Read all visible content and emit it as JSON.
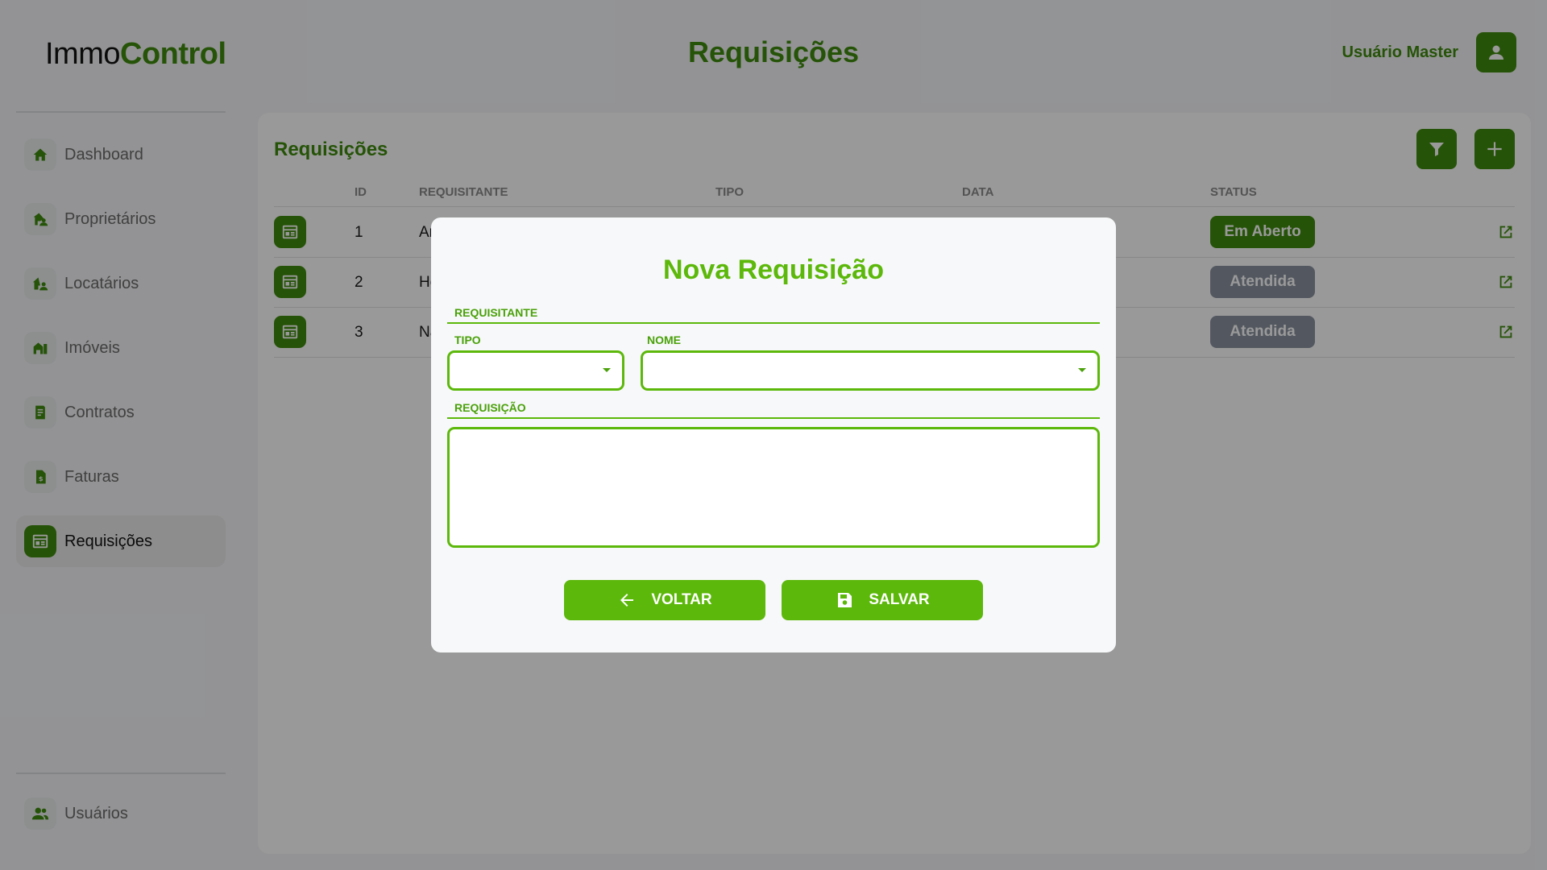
{
  "logo": {
    "part1": "Immo",
    "part2": "Control"
  },
  "header": {
    "title": "Requisições",
    "user_name": "Usuário Master"
  },
  "sidebar": {
    "items": [
      {
        "label": "Dashboard",
        "icon": "home-icon"
      },
      {
        "label": "Proprietários",
        "icon": "owner-icon"
      },
      {
        "label": "Locatários",
        "icon": "tenant-icon"
      },
      {
        "label": "Imóveis",
        "icon": "building-icon"
      },
      {
        "label": "Contratos",
        "icon": "contract-icon"
      },
      {
        "label": "Faturas",
        "icon": "invoice-icon"
      },
      {
        "label": "Requisições",
        "icon": "requests-icon",
        "active": true
      }
    ],
    "bottom_item": {
      "label": "Usuários",
      "icon": "users-icon"
    }
  },
  "panel": {
    "title": "Requisições",
    "columns": [
      "ID",
      "REQUISITANTE",
      "TIPO",
      "DATA",
      "STATUS"
    ],
    "rows": [
      {
        "id": "1",
        "requisitante": "Ar",
        "status": "Em Aberto"
      },
      {
        "id": "2",
        "requisitante": "He",
        "status": "Atendida"
      },
      {
        "id": "3",
        "requisitante": "Na",
        "status": "Atendida"
      }
    ]
  },
  "modal": {
    "title": "Nova Requisição",
    "section_requisitante": "REQUISITANTE",
    "tipo_label": "TIPO",
    "tipo_value": "",
    "nome_label": "NOME",
    "nome_value": "",
    "section_requisicao": "REQUISIÇÃO",
    "requisicao_value": "",
    "back_label": "VOLTAR",
    "save_label": "SALVAR"
  },
  "colors": {
    "brand_dark": "#3e8a0c",
    "brand_bright": "#5cb80a",
    "status_open": "#3e8a0c",
    "status_done": "#8b93a1"
  }
}
